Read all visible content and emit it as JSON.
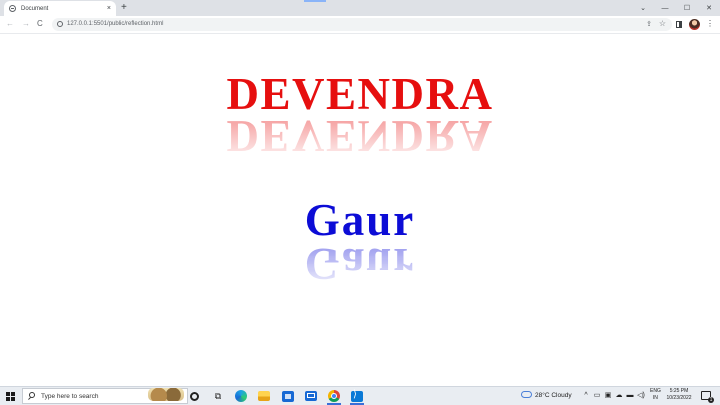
{
  "browser": {
    "tab_title": "Document",
    "tab_close": "×",
    "new_tab": "+",
    "url": "127.0.0.1:5501/public/reflection.html",
    "nav": {
      "back": "←",
      "forward": "→",
      "reload": "C"
    },
    "window_controls": {
      "minimize": "—",
      "maximize": "☐",
      "close": "✕",
      "tab_search": "⌄"
    },
    "icons": [
      "site-info-icon",
      "share-icon",
      "star-icon",
      "side-panel-icon",
      "profile-avatar",
      "menu-icon"
    ]
  },
  "page": {
    "first_name": "DEVENDRA",
    "last_name": "Gaur",
    "colors": {
      "first_name": "#e60f0f",
      "last_name": "#0c0cd6"
    }
  },
  "taskbar": {
    "search_placeholder": "Type here to search",
    "weather": "28°C  Cloudy",
    "language": {
      "line1": "ENG",
      "line2": "IN"
    },
    "clock": {
      "time": "5:25 PM",
      "date": "10/23/2022"
    },
    "tray_icons": [
      "^",
      "▭",
      "▣",
      "☁",
      "▬",
      "◁)"
    ],
    "apps": [
      "cortana",
      "task-view",
      "edge",
      "file-explorer",
      "microsoft-store",
      "mail",
      "chrome",
      "vs-code"
    ]
  }
}
